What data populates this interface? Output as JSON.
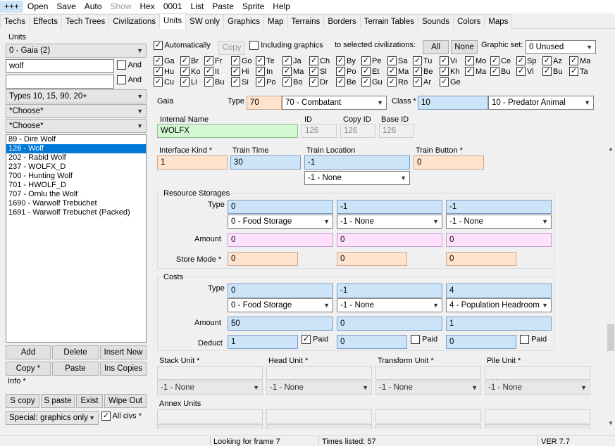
{
  "menu": [
    "+++",
    "Open",
    "Save",
    "Auto",
    "Show",
    "Hex",
    "0001",
    "List",
    "Paste",
    "Sprite",
    "Help"
  ],
  "tabs": [
    "Techs",
    "Effects",
    "Tech Trees",
    "Civilizations",
    "Units",
    "SW only",
    "Graphics",
    "Map",
    "Terrains",
    "Borders",
    "Terrain Tables",
    "Sounds",
    "Colors",
    "Maps"
  ],
  "left": {
    "units_label": "Units",
    "civ_select": "0 - Gaia (2)",
    "search1": "wolf",
    "search2": "",
    "and1": "And",
    "and2": "And",
    "types_select": "Types 10, 15, 90, 20+",
    "choose1": "*Choose*",
    "choose2": "*Choose*",
    "list": [
      "89 - Dire Wolf",
      "126 - Wolf",
      "202 - Rabid Wolf",
      "237 - WOLFX_D",
      "700 - Hunting Wolf",
      "701 - HWOLF_D",
      "707 - Ornlu the Wolf",
      "1690 - Warwolf Trebuchet",
      "1691 - Warwolf Trebuchet (Packed)"
    ],
    "selected_index": 1,
    "add": "Add",
    "delete": "Delete",
    "insert_new": "Insert New",
    "copy": "Copy *",
    "paste": "Paste",
    "ins_copies": "Ins Copies",
    "info": "Info *",
    "s_copy": "S copy",
    "s_paste": "S paste",
    "exist": "Exist",
    "wipe_out": "Wipe Out",
    "special": "Special: graphics only",
    "all_civs": "All civs *"
  },
  "top": {
    "automatically": "Automatically",
    "copy": "Copy",
    "including_graphics": "Including graphics",
    "to_selected": "to selected civilizations:",
    "all": "All",
    "none": "None",
    "graphic_set_label": "Graphic set:",
    "graphic_set": "0 Unused"
  },
  "civs": [
    "Ga",
    "Br",
    "Fr",
    "Go",
    "Te",
    "Ja",
    "Ch",
    "By",
    "Pe",
    "Sa",
    "Tu",
    "Vi",
    "Mo",
    "Ce",
    "Sp",
    "Az",
    "Ma",
    "Hu",
    "Ko",
    "It",
    "Hi",
    "In",
    "Ma",
    "Sl",
    "Po",
    "Et",
    "Ma",
    "Be",
    "Kh",
    "Ma",
    "Bu",
    "Vi",
    "Bu",
    "Ta",
    "Cu",
    "Li",
    "Bu",
    "Si",
    "Po",
    "Bo",
    "Dr",
    "Be",
    "Gu",
    "Ro",
    "Ar",
    "Ge"
  ],
  "header": {
    "gaia": "Gaia",
    "type_label": "Type",
    "type_value": "70",
    "type_select": "70 - Combatant",
    "class_label": "Class *",
    "class_value": "10",
    "class_select": "10 - Predator Animal",
    "internal_name_label": "Internal Name",
    "internal_name": "WOLFX",
    "id_label": "ID",
    "id": "126",
    "copy_id_label": "Copy ID",
    "copy_id": "126",
    "base_id_label": "Base ID",
    "base_id": "126"
  },
  "panel": {
    "interface_kind_label": "Interface Kind *",
    "interface_kind": "1",
    "train_time_label": "Train Time",
    "train_time": "30",
    "train_location_label": "Train Location",
    "train_location": "-1",
    "train_location_select": "-1 - None",
    "train_button_label": "Train Button *",
    "train_button": "0",
    "resource_storages": "Resource Storages",
    "rs_type_label": "Type",
    "rs_types": [
      "0",
      "-1",
      "-1"
    ],
    "rs_type_selects": [
      "0 - Food Storage",
      "-1 - None",
      "-1 - None"
    ],
    "rs_amount_label": "Amount",
    "rs_amounts": [
      "0",
      "0",
      "0"
    ],
    "rs_store_label": "Store Mode *",
    "rs_store_modes": [
      "0",
      "0",
      "0"
    ],
    "costs": "Costs",
    "c_type_label": "Type",
    "c_types": [
      "0",
      "-1",
      "4"
    ],
    "c_type_selects": [
      "0 - Food Storage",
      "-1 - None",
      "4 - Population Headroom"
    ],
    "c_amount_label": "Amount",
    "c_amounts": [
      "50",
      "0",
      "1"
    ],
    "c_deduct_label": "Deduct",
    "c_deducts": [
      "1",
      "0",
      "0"
    ],
    "paid": "Paid",
    "stack_unit": "Stack Unit *",
    "head_unit": "Head Unit *",
    "transform_unit": "Transform Unit *",
    "pile_unit": "Pile Unit *",
    "none_select": "-1 - None",
    "annex_units": "Annex Units"
  },
  "status": {
    "looking": "Looking for frame 7",
    "times": "Times listed: 57",
    "ver": "VER 7.7"
  }
}
